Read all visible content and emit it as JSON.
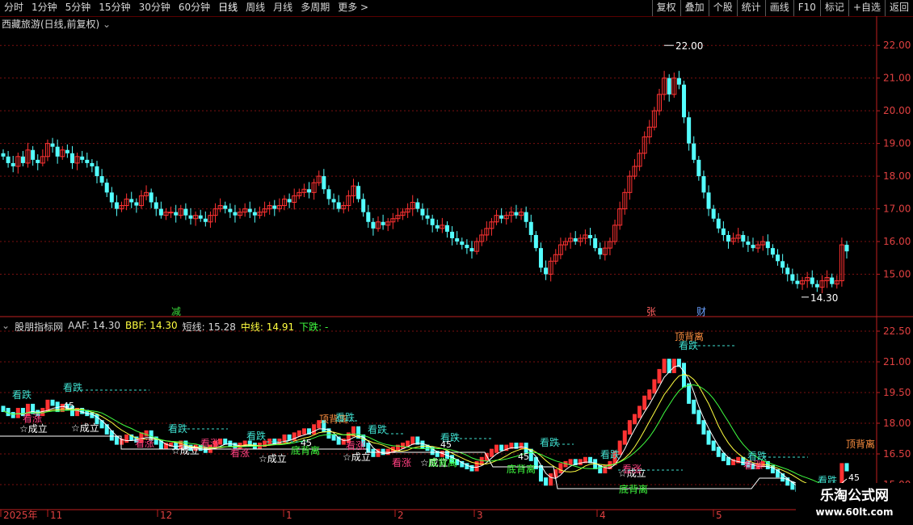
{
  "toolbar": {
    "periods": [
      "分时",
      "1分钟",
      "5分钟",
      "15分钟",
      "30分钟",
      "60分钟",
      "日线",
      "周线",
      "月线",
      "多周期",
      "更多 >"
    ],
    "active_period": "日线",
    "tools": [
      "复权",
      "叠加",
      "个股",
      "统计",
      "画线",
      "F10",
      "标记",
      "+自选",
      "返回"
    ]
  },
  "main_panel": {
    "title": "西藏旅游(日线,前复权)",
    "y_ticks": [
      "22.00",
      "21.00",
      "20.00",
      "19.00",
      "18.00",
      "17.00",
      "16.00",
      "15.00"
    ],
    "high_label": "22.00",
    "low_label": "14.30",
    "markers": [
      {
        "text": "减",
        "color": "#3bd93b"
      },
      {
        "text": "张",
        "color": "#ff6060"
      },
      {
        "text": "财",
        "color": "#6aa0ff"
      }
    ]
  },
  "indicator_panel": {
    "name": "股朋指标网",
    "readouts": [
      {
        "label": "AAF: 14.30",
        "color": "#d8d8d8"
      },
      {
        "label": "BBF: 14.30",
        "color": "#ffff40"
      },
      {
        "label": "短线: 15.28",
        "color": "#d8d8d8"
      },
      {
        "label": "中线: 14.91",
        "color": "#ffff40"
      },
      {
        "label": "下跌: -",
        "color": "#40ff40"
      }
    ],
    "y_ticks": [
      "22.50",
      "21.00",
      "19.50",
      "18.00",
      "16.50",
      "15.00"
    ],
    "annotations": [
      {
        "text": "看跌",
        "color": "#40e0d0"
      },
      {
        "text": "看涨",
        "color": "#ff4080"
      },
      {
        "text": "☆成立",
        "color": "#ffffff"
      },
      {
        "text": "顶背离",
        "color": "#ff9040"
      },
      {
        "text": "底背离",
        "color": "#40ff40"
      },
      {
        "text": "45",
        "color": "#ffffff"
      }
    ]
  },
  "time_axis": [
    "2025年",
    "11",
    "12",
    "1",
    "2",
    "3",
    "4",
    "5"
  ],
  "watermark": {
    "line1": "乐淘公式网",
    "line2": "www.60lt.com"
  },
  "colors": {
    "up": "#ff3232",
    "down": "#54ffff",
    "grid": "#7a1010",
    "axis": "#c02020",
    "white_line": "#ffffff",
    "yellow_line": "#ffff40",
    "green_line": "#40ff40"
  },
  "chart_data": {
    "type": "candlestick",
    "ylim": [
      14.0,
      22.4
    ],
    "open": [
      18.7,
      18.6,
      18.4,
      18.3,
      18.6,
      18.4,
      18.8,
      18.5,
      18.4,
      18.6,
      19.0,
      18.9,
      18.6,
      18.8,
      18.7,
      18.4,
      18.6,
      18.5,
      18.4,
      18.3,
      18.0,
      17.8,
      17.5,
      17.2,
      17.0,
      17.1,
      17.3,
      17.2,
      17.1,
      17.4,
      17.5,
      17.2,
      17.0,
      16.8,
      16.9,
      16.9,
      16.8,
      17.0,
      16.8,
      16.7,
      16.8,
      16.7,
      16.6,
      16.8,
      17.0,
      17.1,
      17.0,
      16.9,
      16.8,
      16.9,
      17.0,
      16.9,
      16.8,
      16.9,
      17.0,
      17.1,
      17.0,
      17.1,
      17.3,
      17.2,
      17.4,
      17.5,
      17.6,
      17.5,
      17.8,
      18.0,
      17.6,
      17.3,
      17.2,
      17.0,
      17.1,
      17.4,
      17.7,
      17.3,
      16.9,
      16.6,
      16.4,
      16.6,
      16.5,
      16.6,
      16.7,
      16.8,
      16.9,
      17.0,
      17.2,
      17.0,
      16.8,
      16.7,
      16.5,
      16.4,
      16.5,
      16.3,
      16.1,
      16.0,
      15.9,
      15.8,
      15.7,
      16.0,
      16.2,
      16.4,
      16.6,
      16.8,
      16.7,
      16.8,
      16.9,
      16.8,
      16.9,
      16.6,
      16.2,
      15.8,
      15.2,
      15.0,
      15.4,
      15.6,
      15.9,
      16.0,
      16.1,
      16.0,
      16.1,
      16.2,
      16.1,
      15.8,
      15.6,
      15.8,
      16.0,
      16.5,
      17.0,
      17.5,
      18.0,
      18.3,
      18.7,
      19.2,
      19.5,
      20.0,
      20.5,
      21.0,
      20.5,
      21.0,
      20.8,
      19.8,
      19.0,
      18.5,
      18.0,
      17.5,
      17.0,
      16.7,
      16.4,
      16.2,
      16.0,
      16.1,
      16.2,
      16.0,
      15.9,
      15.8,
      15.9,
      16.0,
      15.8,
      15.6,
      15.4,
      15.2,
      15.0,
      14.8,
      14.7,
      14.8,
      14.9,
      14.7,
      14.6,
      14.8,
      14.9,
      14.7,
      14.8,
      15.9
    ],
    "close": [
      18.6,
      18.4,
      18.3,
      18.6,
      18.4,
      18.8,
      18.5,
      18.4,
      18.6,
      19.0,
      18.9,
      18.6,
      18.8,
      18.7,
      18.4,
      18.6,
      18.5,
      18.4,
      18.3,
      18.0,
      17.8,
      17.5,
      17.2,
      17.0,
      17.1,
      17.3,
      17.2,
      17.1,
      17.4,
      17.5,
      17.2,
      17.0,
      16.8,
      16.9,
      16.9,
      16.8,
      17.0,
      16.8,
      16.7,
      16.8,
      16.7,
      16.6,
      16.8,
      17.0,
      17.1,
      17.0,
      16.9,
      16.8,
      16.9,
      17.0,
      16.9,
      16.8,
      16.9,
      17.0,
      17.1,
      17.0,
      17.1,
      17.3,
      17.2,
      17.4,
      17.5,
      17.6,
      17.5,
      17.8,
      18.0,
      17.6,
      17.3,
      17.2,
      17.0,
      17.1,
      17.4,
      17.7,
      17.3,
      16.9,
      16.6,
      16.4,
      16.6,
      16.5,
      16.6,
      16.7,
      16.8,
      16.9,
      17.0,
      17.2,
      17.0,
      16.8,
      16.7,
      16.5,
      16.4,
      16.5,
      16.3,
      16.1,
      16.0,
      15.9,
      15.8,
      15.7,
      16.0,
      16.2,
      16.4,
      16.6,
      16.8,
      16.7,
      16.8,
      16.9,
      16.8,
      16.9,
      16.6,
      16.2,
      15.8,
      15.2,
      15.0,
      15.4,
      15.6,
      15.9,
      16.0,
      16.1,
      16.0,
      16.1,
      16.2,
      16.1,
      15.8,
      15.6,
      15.8,
      16.0,
      16.5,
      17.0,
      17.5,
      18.0,
      18.3,
      18.7,
      19.2,
      19.5,
      20.0,
      20.5,
      21.0,
      20.5,
      21.0,
      20.8,
      19.8,
      19.0,
      18.5,
      18.0,
      17.5,
      17.0,
      16.7,
      16.4,
      16.2,
      16.0,
      16.1,
      16.2,
      16.0,
      15.9,
      15.8,
      15.9,
      16.0,
      15.8,
      15.6,
      15.4,
      15.2,
      15.0,
      14.8,
      14.7,
      14.8,
      14.9,
      14.7,
      14.6,
      14.8,
      14.9,
      14.7,
      14.8,
      15.9,
      15.7
    ]
  }
}
